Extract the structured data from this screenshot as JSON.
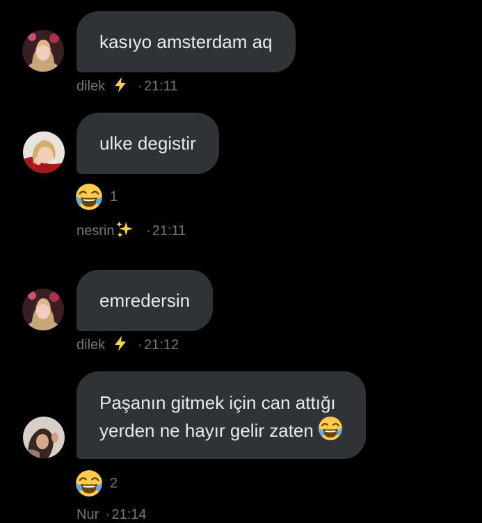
{
  "messages": [
    {
      "id": "m1",
      "author": "dilek",
      "author_emoji": "⚡",
      "lines": [
        "kasıyo amsterdam aq"
      ],
      "sep": "·",
      "time": "21:11"
    },
    {
      "id": "m2",
      "author": "nesrin",
      "author_emoji": "✨",
      "lines": [
        "ulke degistir"
      ],
      "reaction": {
        "emoji": "face-with-tears-of-joy",
        "count": "1"
      },
      "sep": "·",
      "time": "21:11"
    },
    {
      "id": "m3",
      "author": "dilek",
      "author_emoji": "⚡",
      "lines": [
        "emredersin"
      ],
      "sep": "·",
      "time": "21:12"
    },
    {
      "id": "m4",
      "author": "Nur",
      "author_emoji": "",
      "lines": [
        "Paşanın gitmek için can attığı",
        "yerden ne hayır gelir zaten"
      ],
      "inline_emoji": "face-with-tears-of-joy",
      "reaction": {
        "emoji": "face-with-tears-of-joy",
        "count": "2"
      },
      "sep": "·",
      "time": "21:14"
    }
  ],
  "colors": {
    "background": "#000000",
    "bubble": "#2f3336",
    "text": "#e7e9ea",
    "meta": "#71767b",
    "lightning": "#ffd23f",
    "emoji_face": "#ffcc4d",
    "emoji_tears": "#5dadec"
  }
}
